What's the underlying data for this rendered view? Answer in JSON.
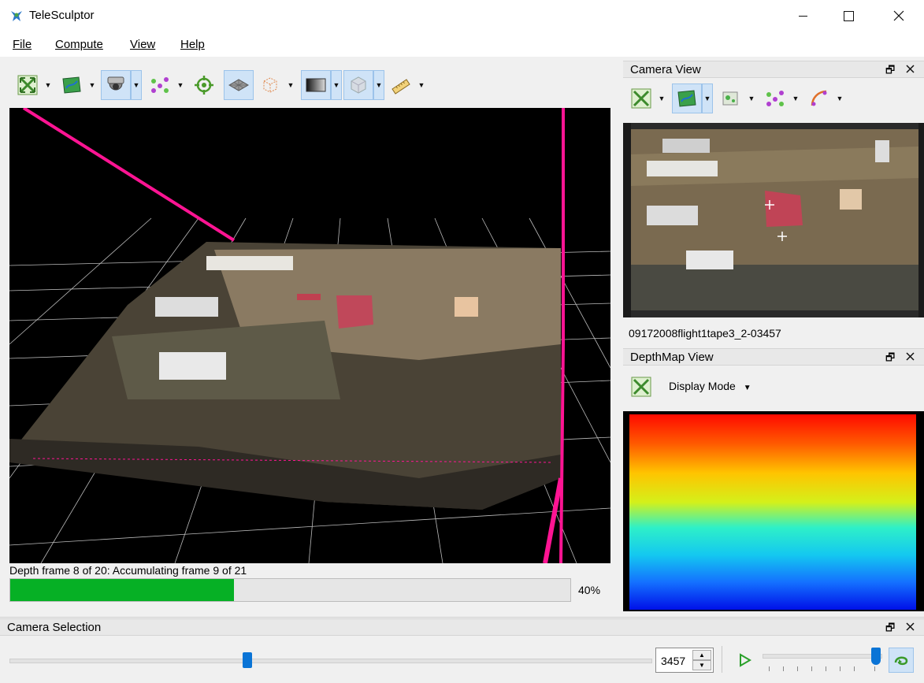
{
  "window": {
    "title": "TeleSculptor",
    "app_icon": "telesculptor-logo-icon",
    "minimize_icon": "minimize-icon",
    "maximize_icon": "maximize-icon",
    "close_icon": "close-icon"
  },
  "menu": {
    "items": [
      {
        "label": "File"
      },
      {
        "label": "Compute"
      },
      {
        "label": "View"
      },
      {
        "label": "Help"
      }
    ]
  },
  "world_toolbar": {
    "buttons": [
      {
        "icon": "reset-view-icon",
        "has_menu": true,
        "active": false
      },
      {
        "icon": "image-icon",
        "has_menu": true,
        "active": false
      },
      {
        "icon": "camera-icon",
        "has_menu": true,
        "active": true
      },
      {
        "icon": "landmarks-icon",
        "has_menu": true,
        "active": false
      },
      {
        "icon": "ground-control-points-icon",
        "has_menu": false,
        "active": false
      },
      {
        "icon": "ground-plane-icon",
        "has_menu": false,
        "active": true
      },
      {
        "icon": "bounding-box-icon",
        "has_menu": true,
        "active": false
      },
      {
        "icon": "depth-map-icon",
        "has_menu": true,
        "active": true
      },
      {
        "icon": "volume-surface-icon",
        "has_menu": true,
        "active": true
      },
      {
        "icon": "measure-ruler-icon",
        "has_menu": true,
        "active": false
      }
    ]
  },
  "progress": {
    "label": "Depth frame 8 of 20: Accumulating frame 9 of 21",
    "percent_text": "40%",
    "fraction": 0.4
  },
  "camera_view": {
    "title": "Camera View",
    "float_icon": "undock-icon",
    "close_icon": "close-icon",
    "toolbar": [
      {
        "icon": "reset-view-icon",
        "has_menu": true,
        "active": false
      },
      {
        "icon": "image-icon",
        "has_menu": true,
        "active": true
      },
      {
        "icon": "feature-points-icon",
        "has_menu": true,
        "active": false
      },
      {
        "icon": "landmarks-icon",
        "has_menu": true,
        "active": false
      },
      {
        "icon": "residuals-icon",
        "has_menu": true,
        "active": false
      }
    ],
    "frame_name": "09172008flight1tape3_2-03457"
  },
  "depthmap_view": {
    "title": "DepthMap View",
    "float_icon": "undock-icon",
    "close_icon": "close-icon",
    "reset_icon": "reset-view-icon",
    "display_mode_label": "Display Mode",
    "dropdown_icon": "chevron-down-icon"
  },
  "camera_selection": {
    "title": "Camera Selection",
    "float_icon": "undock-icon",
    "close_icon": "close-icon",
    "frame_value": "3457",
    "frame_fraction": 0.37,
    "speed_fraction": 0.95,
    "play_icon": "play-icon",
    "loop_icon": "loop-icon"
  },
  "colors": {
    "accent": "#0a74d6",
    "progress": "#06b025",
    "camera_path": "#ff1493",
    "toggle_bg": "#cfe3f7"
  }
}
